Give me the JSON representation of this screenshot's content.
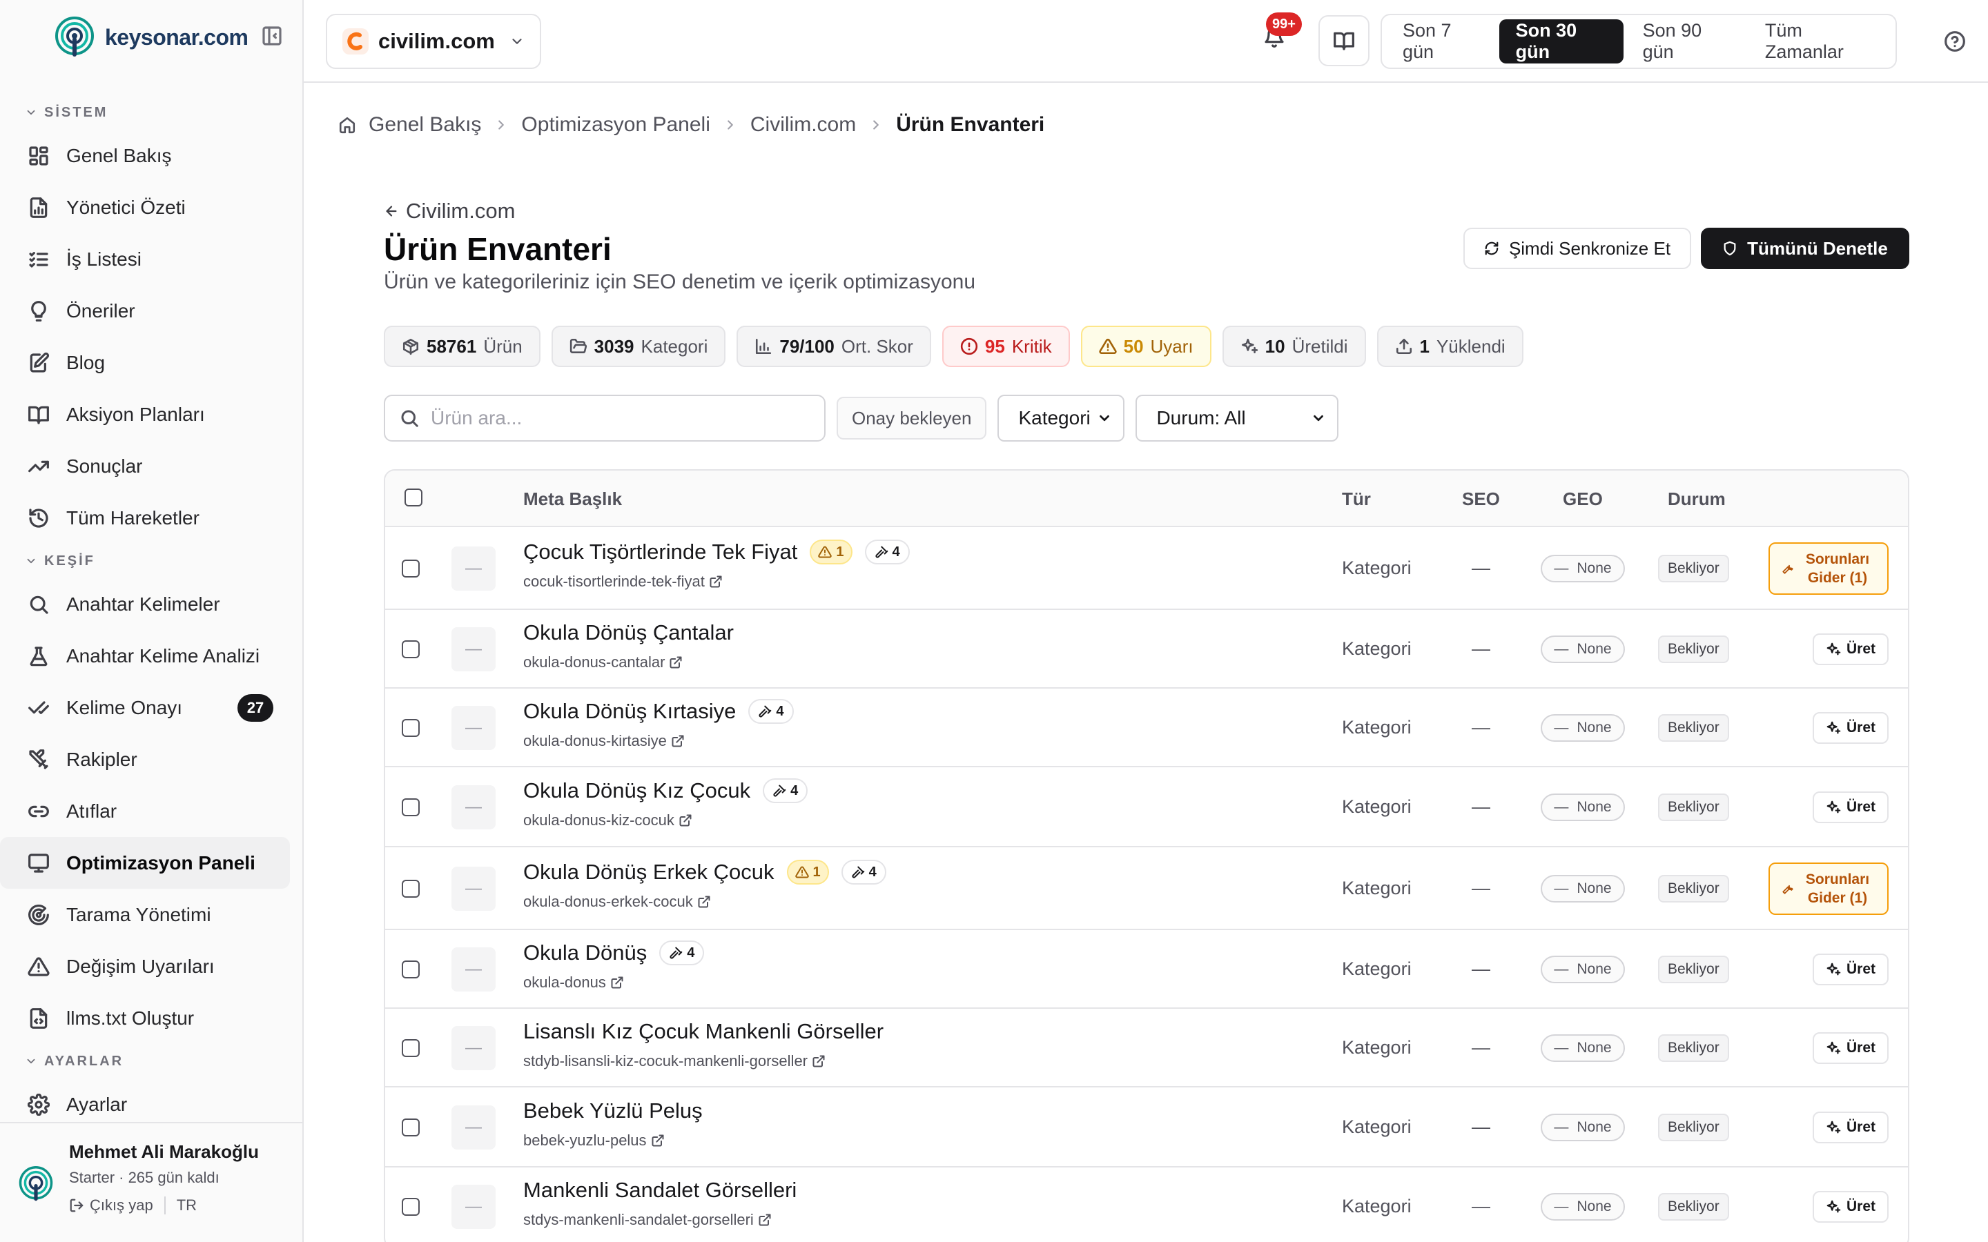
{
  "brand": {
    "name": "keysonar.com",
    "accent": "#0f766e"
  },
  "sidebar": {
    "sections": [
      {
        "label": "SİSTEM",
        "items": [
          {
            "label": "Genel Bakış",
            "icon": "layout-grid-icon"
          },
          {
            "label": "Yönetici Özeti",
            "icon": "report-icon"
          },
          {
            "label": "İş Listesi",
            "icon": "checklist-icon"
          },
          {
            "label": "Öneriler",
            "icon": "lightbulb-icon"
          },
          {
            "label": "Blog",
            "icon": "edit-file-icon"
          },
          {
            "label": "Aksiyon Planları",
            "icon": "book-open-icon"
          },
          {
            "label": "Sonuçlar",
            "icon": "trending-up-icon"
          },
          {
            "label": "Tüm Hareketler",
            "icon": "history-icon"
          }
        ]
      },
      {
        "label": "KEŞİF",
        "items": [
          {
            "label": "Anahtar Kelimeler",
            "icon": "search-icon"
          },
          {
            "label": "Anahtar Kelime Analizi",
            "icon": "flask-icon"
          },
          {
            "label": "Kelime Onayı",
            "icon": "check-check-icon",
            "badge": "27"
          },
          {
            "label": "Rakipler",
            "icon": "swords-icon"
          },
          {
            "label": "Atıflar",
            "icon": "link-icon"
          },
          {
            "label": "Optimizasyon Paneli",
            "icon": "monitor-icon",
            "active": true
          },
          {
            "label": "Tarama Yönetimi",
            "icon": "radar-icon"
          },
          {
            "label": "Değişim Uyarıları",
            "icon": "alert-triangle-icon"
          },
          {
            "label": "llms.txt Oluştur",
            "icon": "file-code-icon"
          }
        ]
      },
      {
        "label": "AYARLAR",
        "items": [
          {
            "label": "Ayarlar",
            "icon": "gear-icon"
          }
        ]
      }
    ],
    "user": {
      "name": "Mehmet Ali Marakoğlu",
      "plan": "Starter · 265 gün kaldı",
      "logout": "Çıkış yap",
      "lang": "TR"
    }
  },
  "topbar": {
    "site": "civilim.com",
    "notifications": "99+",
    "ranges": [
      "Son 7 gün",
      "Son 30 gün",
      "Son 90 gün",
      "Tüm Zamanlar"
    ],
    "active_range": "Son 30 gün"
  },
  "breadcrumb": [
    "Genel Bakış",
    "Optimizasyon Paneli",
    "Civilim.com",
    "Ürün Envanteri"
  ],
  "page": {
    "back": "Civilim.com",
    "title": "Ürün Envanteri",
    "subtitle": "Ürün ve kategorileriniz için SEO denetim ve içerik optimizasyonu",
    "sync_label": "Şimdi Senkronize Et",
    "audit_label": "Tümünü Denetle"
  },
  "stats": [
    {
      "value": "58761",
      "label": "Ürün",
      "icon": "package-icon",
      "tone": "neutral"
    },
    {
      "value": "3039",
      "label": "Kategori",
      "icon": "folder-open-icon",
      "tone": "neutral"
    },
    {
      "value": "79/100",
      "label": "Ort. Skor",
      "icon": "bar-chart-icon",
      "tone": "neutral"
    },
    {
      "value": "95",
      "label": "Kritik",
      "icon": "alert-circle-icon",
      "tone": "red"
    },
    {
      "value": "50",
      "label": "Uyarı",
      "icon": "alert-triangle-icon",
      "tone": "yellow"
    },
    {
      "value": "10",
      "label": "Üretildi",
      "icon": "sparkles-icon",
      "tone": "neutral"
    },
    {
      "value": "1",
      "label": "Yüklendi",
      "icon": "upload-icon",
      "tone": "neutral"
    }
  ],
  "filters": {
    "search_placeholder": "Ürün ara...",
    "pending": "Onay bekleyen",
    "category": "Kategori",
    "status": "Durum: All"
  },
  "table": {
    "headers": {
      "meta": "Meta Başlık",
      "type": "Tür",
      "seo": "SEO",
      "geo": "GEO",
      "status": "Durum"
    },
    "rows": [
      {
        "title": "Çocuk Tişörtlerinde Tek Fiyat",
        "slug": "cocuk-tisortlerinde-tek-fiyat",
        "warn": "1",
        "tools": "4",
        "type": "Kategori",
        "seo": "—",
        "geo": "None",
        "status": "Bekliyor",
        "action": "fix",
        "action_label": "Sorunları Gider (1)"
      },
      {
        "title": "Okula Dönüş Çantalar",
        "slug": "okula-donus-cantalar",
        "warn": "",
        "tools": "",
        "type": "Kategori",
        "seo": "—",
        "geo": "None",
        "status": "Bekliyor",
        "action": "generate",
        "action_label": "Üret"
      },
      {
        "title": "Okula Dönüş Kırtasiye",
        "slug": "okula-donus-kirtasiye",
        "warn": "",
        "tools": "4",
        "type": "Kategori",
        "seo": "—",
        "geo": "None",
        "status": "Bekliyor",
        "action": "generate",
        "action_label": "Üret"
      },
      {
        "title": "Okula Dönüş Kız Çocuk",
        "slug": "okula-donus-kiz-cocuk",
        "warn": "",
        "tools": "4",
        "type": "Kategori",
        "seo": "—",
        "geo": "None",
        "status": "Bekliyor",
        "action": "generate",
        "action_label": "Üret"
      },
      {
        "title": "Okula Dönüş Erkek Çocuk",
        "slug": "okula-donus-erkek-cocuk",
        "warn": "1",
        "tools": "4",
        "type": "Kategori",
        "seo": "—",
        "geo": "None",
        "status": "Bekliyor",
        "action": "fix",
        "action_label": "Sorunları Gider (1)"
      },
      {
        "title": "Okula Dönüş",
        "slug": "okula-donus",
        "warn": "",
        "tools": "4",
        "type": "Kategori",
        "seo": "—",
        "geo": "None",
        "status": "Bekliyor",
        "action": "generate",
        "action_label": "Üret"
      },
      {
        "title": "Lisanslı Kız Çocuk Mankenli Görseller",
        "slug": "stdyb-lisansli-kiz-cocuk-mankenli-gorseller",
        "warn": "",
        "tools": "",
        "type": "Kategori",
        "seo": "—",
        "geo": "None",
        "status": "Bekliyor",
        "action": "generate",
        "action_label": "Üret"
      },
      {
        "title": "Bebek Yüzlü Peluş",
        "slug": "bebek-yuzlu-pelus",
        "warn": "",
        "tools": "",
        "type": "Kategori",
        "seo": "—",
        "geo": "None",
        "status": "Bekliyor",
        "action": "generate",
        "action_label": "Üret"
      },
      {
        "title": "Mankenli Sandalet Görselleri",
        "slug": "stdys-mankenli-sandalet-gorselleri",
        "warn": "",
        "tools": "",
        "type": "Kategori",
        "seo": "—",
        "geo": "None",
        "status": "Bekliyor",
        "action": "generate",
        "action_label": "Üret"
      }
    ]
  }
}
